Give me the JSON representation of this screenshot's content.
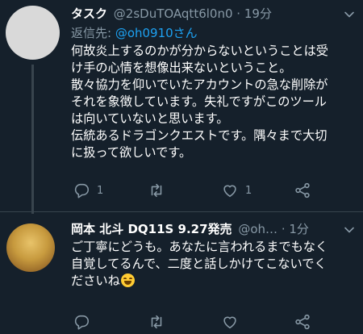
{
  "tweets": [
    {
      "author_name": "タスク",
      "handle": "@2sDuTOAqtt6l0n0",
      "separator": "·",
      "time": "19分",
      "reply_prefix": "返信先: ",
      "reply_handle": "@oh0910さん",
      "lines": [
        "何故炎上するのかが分からないということは受",
        "け手の心情を想像出来ないということ。",
        "散々協力を仰いでいたアカウントの急な削除が",
        "それを象徴しています。失礼ですがこのツール",
        "は向いていないと思います。",
        "伝統あるドラゴンクエストです。隅々まで大切",
        "に扱って欲しいです。"
      ],
      "reply_count": "1",
      "retweet_count": "",
      "like_count": "1"
    },
    {
      "author_name": "岡本 北斗 DQ11S 9.27発売",
      "handle": "@oh…",
      "separator": "·",
      "time": "1分",
      "lines": [
        "ご丁寧にどうも。あなたに言われるまでもなく",
        "自覚してるんで、二度と話しかけてこないでく",
        "ださいね"
      ],
      "emoji": "grinning-face"
    }
  ],
  "colors": {
    "background": "#15202b",
    "text": "#ffffff",
    "secondary": "#8899a6",
    "link": "#1da1f2",
    "divider": "#38444d"
  }
}
